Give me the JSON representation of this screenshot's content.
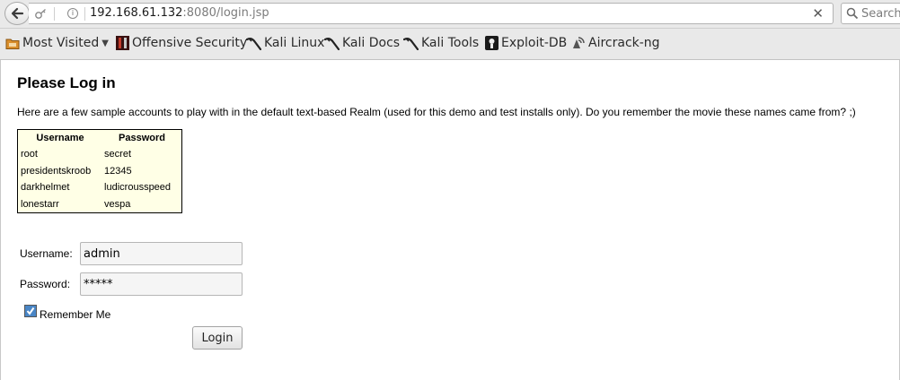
{
  "browser": {
    "url_host": "192.168.61.132",
    "url_rest": ":8080/login.jsp",
    "search_placeholder": "Search",
    "bookmarks": [
      {
        "label": "Most Visited",
        "icon": "folder-icon"
      },
      {
        "label": "Offensive Security",
        "icon": "offensive-security-icon"
      },
      {
        "label": "Kali Linux",
        "icon": "kali-dragon-icon"
      },
      {
        "label": "Kali Docs",
        "icon": "kali-dragon-icon"
      },
      {
        "label": "Kali Tools",
        "icon": "kali-dragon-icon"
      },
      {
        "label": "Exploit-DB",
        "icon": "exploit-db-icon"
      },
      {
        "label": "Aircrack-ng",
        "icon": "aircrack-icon"
      }
    ]
  },
  "page": {
    "title": "Please Log in",
    "intro": "Here are a few sample accounts to play with in the default text-based Realm (used for this demo and test installs only). Do you remember the movie these names came from? ;)",
    "table": {
      "headers": [
        "Username",
        "Password"
      ],
      "rows": [
        [
          "root",
          "secret"
        ],
        [
          "presidentskroob",
          "12345"
        ],
        [
          "darkhelmet",
          "ludicrousspeed"
        ],
        [
          "lonestarr",
          "vespa"
        ]
      ]
    },
    "form": {
      "username_label": "Username:",
      "username_value": "admin",
      "password_label": "Password:",
      "password_value": "*****",
      "remember_label": "Remember Me",
      "remember_checked": true,
      "login_label": "Login"
    }
  },
  "colors": {
    "table_background": "#ffffe6",
    "checkbox_accent": "#4a86c6"
  }
}
